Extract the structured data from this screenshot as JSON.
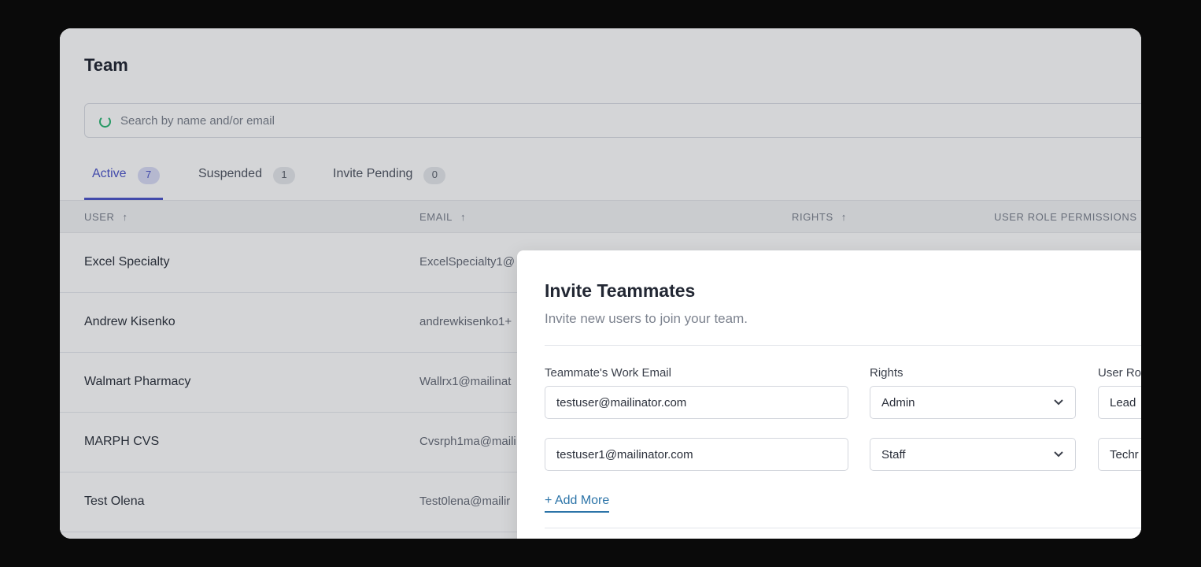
{
  "page": {
    "title": "Team"
  },
  "search": {
    "placeholder": "Search by name and/or email"
  },
  "tabs": [
    {
      "label": "Active",
      "count": "7"
    },
    {
      "label": "Suspended",
      "count": "1"
    },
    {
      "label": "Invite Pending",
      "count": "0"
    }
  ],
  "table": {
    "columns": [
      "USER",
      "EMAIL",
      "RIGHTS",
      "USER ROLE PERMISSIONS"
    ],
    "sort_icon": "arrow-up-icon",
    "rows": [
      {
        "user": "Excel Specialty",
        "email": "ExcelSpecialty1@"
      },
      {
        "user": "Andrew Kisenko",
        "email": "andrewkisenko1+"
      },
      {
        "user": "Walmart Pharmacy",
        "email": "Wallrx1@mailinat"
      },
      {
        "user": "MARPH CVS",
        "email": "Cvsrph1ma@maili"
      },
      {
        "user": "Test Olena",
        "email": "Test0lena@mailir"
      }
    ]
  },
  "modal": {
    "title": "Invite Teammates",
    "subtitle": "Invite new users to join your team.",
    "labels": {
      "email": "Teammate's Work Email",
      "rights": "Rights",
      "role": "User Ro"
    },
    "invites": [
      {
        "email": "testuser@mailinator.com",
        "rights": "Admin",
        "role": "Lead"
      },
      {
        "email": "testuser1@mailinator.com",
        "rights": "Staff",
        "role": "Techr"
      }
    ],
    "add_more": "+ Add More"
  },
  "colors": {
    "accent": "#4c54c9",
    "link": "#2c74a8",
    "spinner": "#2bb673",
    "backdrop": "#0a0a0a"
  }
}
